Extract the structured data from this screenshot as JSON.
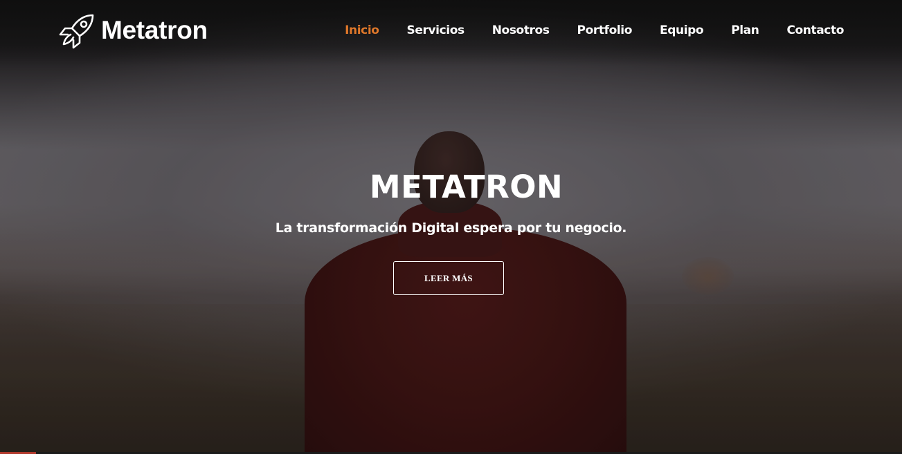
{
  "brand": {
    "name": "Metatron",
    "icon": "rocket-icon"
  },
  "nav": {
    "items": [
      {
        "label": "Inicio",
        "active": true
      },
      {
        "label": "Servicios",
        "active": false
      },
      {
        "label": "Nosotros",
        "active": false
      },
      {
        "label": "Portfolio",
        "active": false
      },
      {
        "label": "Equipo",
        "active": false
      },
      {
        "label": "Plan",
        "active": false
      },
      {
        "label": "Contacto",
        "active": false
      }
    ]
  },
  "hero": {
    "title": "METATRON",
    "subtitle": "La transformación Digital espera por tu negocio.",
    "button_label": "LEER MÁS"
  },
  "colors": {
    "accent": "#e0782a",
    "text": "#ffffff",
    "bottom_accent": "#b0392d"
  }
}
